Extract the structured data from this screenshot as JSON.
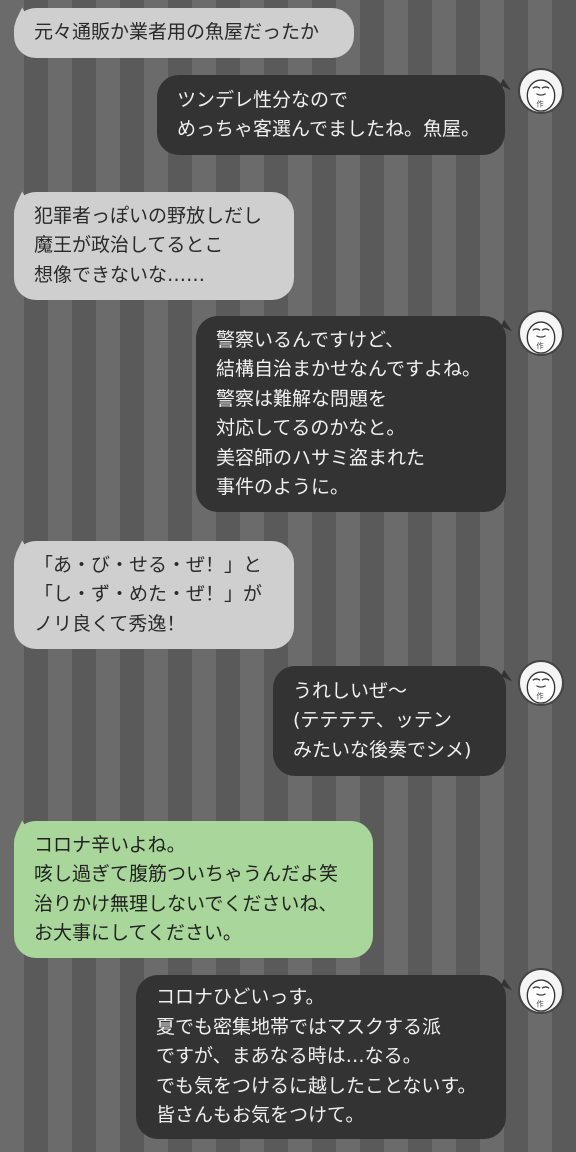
{
  "messages": [
    {
      "side": "left",
      "lines": [
        "元々通販か業者用の魚屋だったか"
      ]
    },
    {
      "side": "right",
      "lines": [
        "ツンデレ性分なので",
        "めっちゃ客選んでましたね。魚屋。"
      ],
      "avatar": "author-avatar-icon"
    },
    {
      "side": "left",
      "lines": [
        "犯罪者っぽいの野放しだし",
        "魔王が政治してるとこ",
        "想像できないな……"
      ]
    },
    {
      "side": "right",
      "lines": [
        "警察いるんですけど、",
        "結構自治まかせなんですよね。",
        "警察は難解な問題を",
        "対応してるのかなと。",
        "美容師のハサミ盗まれた",
        "事件のように。"
      ],
      "avatar": "author-avatar-icon"
    },
    {
      "side": "left",
      "lines": [
        "「あ・び・せる・ぜ！」と",
        "「し・ず・めた・ぜ！」が",
        "ノリ良くて秀逸！"
      ]
    },
    {
      "side": "right",
      "lines": [
        "うれしいぜ〜",
        "(テテテテ、ッテン",
        "みたいな後奏でシメ)"
      ],
      "avatar": "author-avatar-icon"
    },
    {
      "side": "left-green",
      "lines": [
        "コロナ辛いよね。",
        "咳し過ぎて腹筋ついちゃうんだよ笑",
        "治りかけ無理しないでくださいね、",
        "お大事にしてください。"
      ]
    },
    {
      "side": "right",
      "lines": [
        "コロナひどいっす。",
        "夏でも密集地帯ではマスクする派",
        "ですが、まあなる時は…なる。",
        "でも気をつけるに越したことないす。",
        "皆さんもお気をつけて。"
      ],
      "avatar": "author-avatar-icon"
    }
  ],
  "avatar_label": "作",
  "colors": {
    "stripe_light": "#6b6b6b",
    "stripe_dark": "#5a5a5a",
    "bubble_left": "#cfcfcf",
    "bubble_green": "#a9d69a",
    "bubble_right": "#333333"
  }
}
